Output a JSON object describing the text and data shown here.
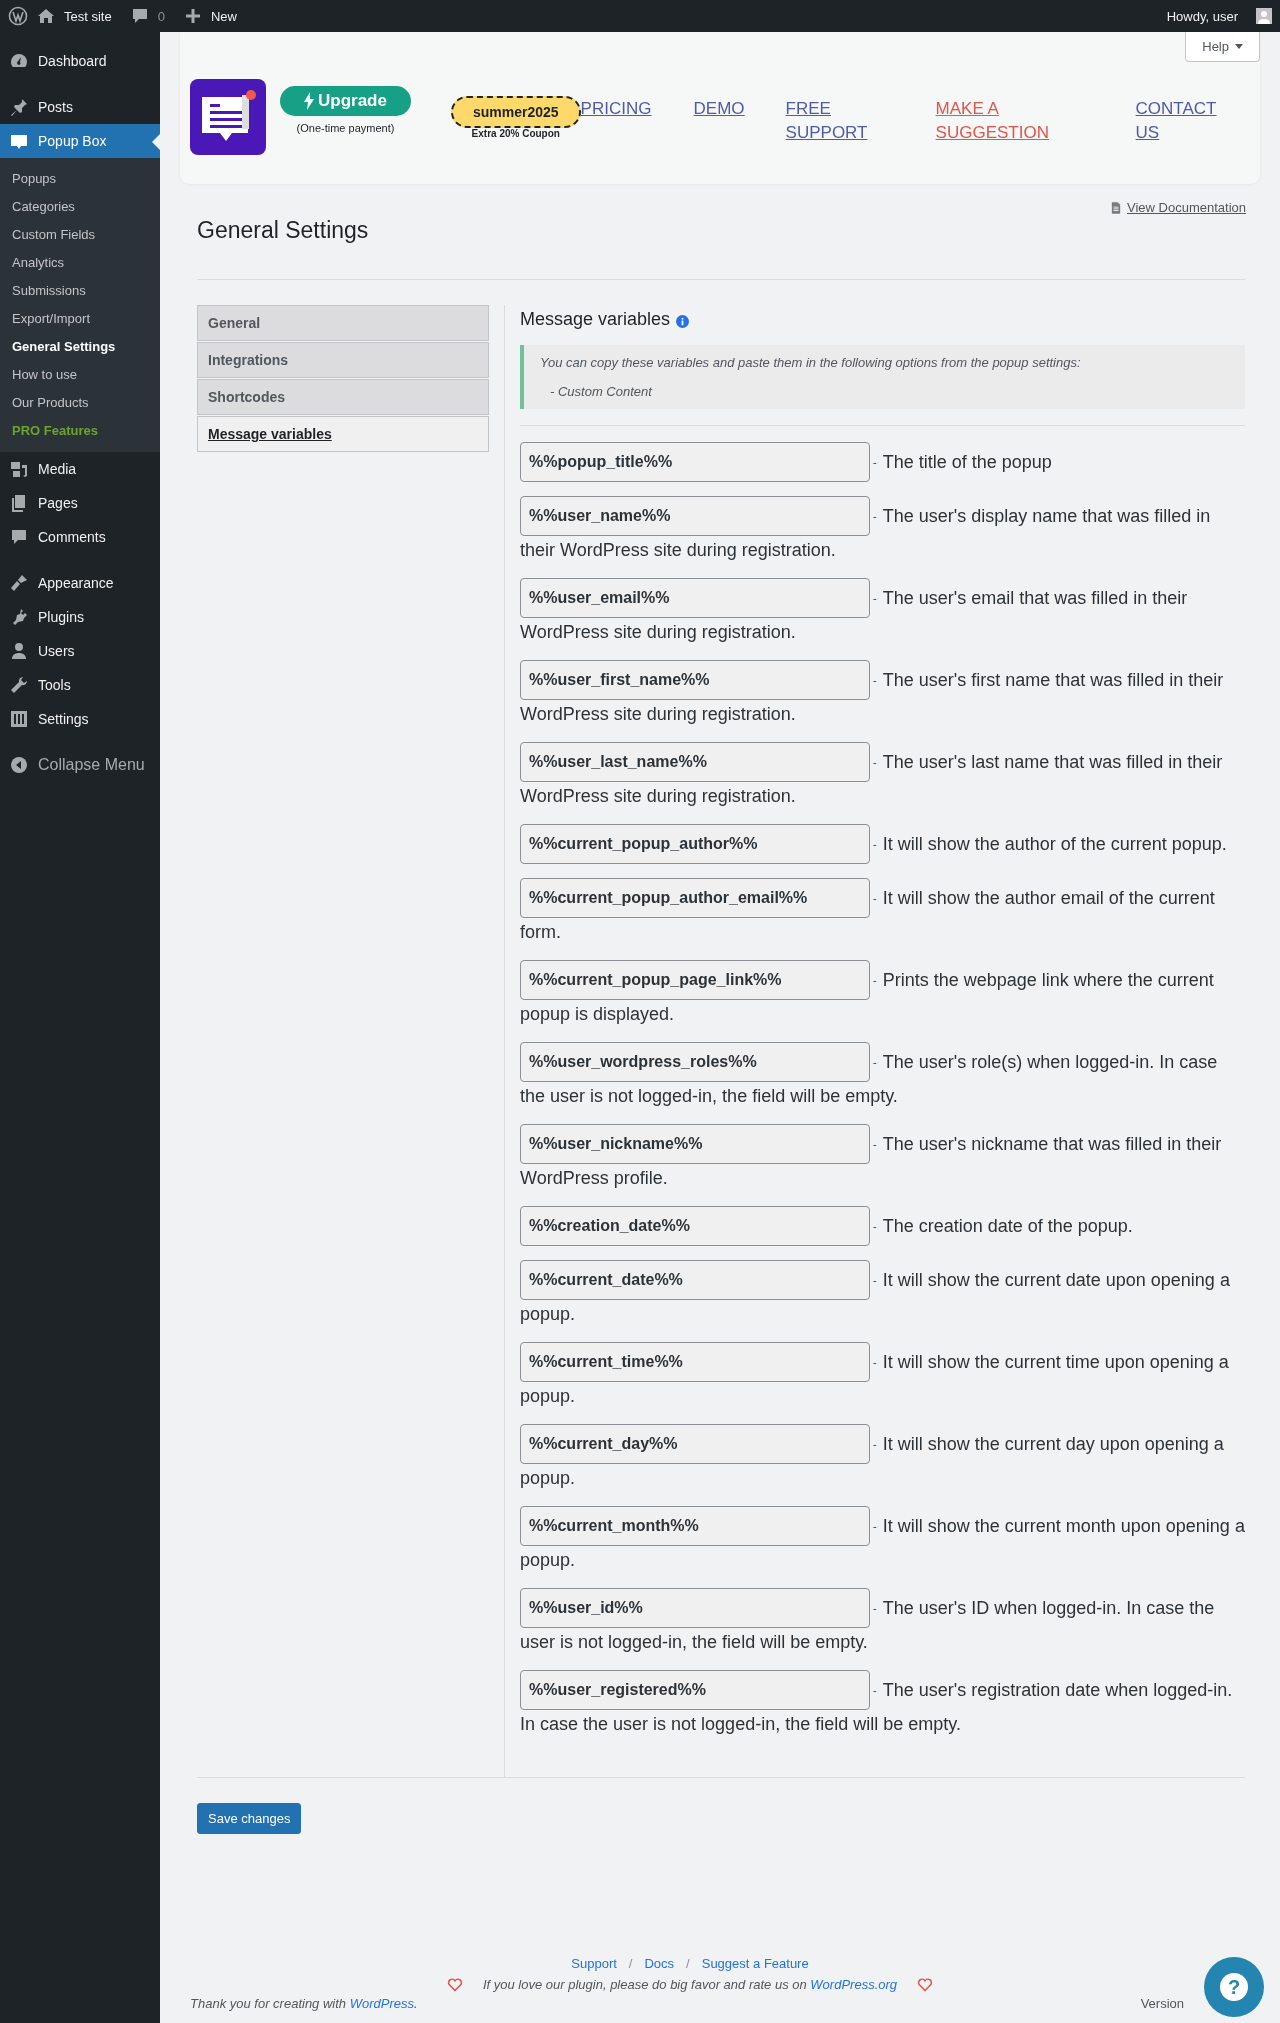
{
  "admin_bar": {
    "site": "Test site",
    "comments": "0",
    "new": "New",
    "greeting": "Howdy, user"
  },
  "sidebar": {
    "groups": [
      [
        {
          "label": "Dashboard",
          "selected": false
        }
      ],
      [
        {
          "label": "Posts",
          "selected": false
        },
        {
          "label": "Popup Box",
          "selected": true,
          "children": [
            {
              "label": "Popups",
              "selected": false,
              "kind": "link"
            },
            {
              "label": "Categories",
              "selected": false,
              "kind": "link"
            },
            {
              "label": "Custom Fields",
              "selected": false,
              "kind": "link"
            },
            {
              "label": "Analytics",
              "selected": false,
              "kind": "link"
            },
            {
              "label": "Submissions",
              "selected": false,
              "kind": "link"
            },
            {
              "label": "Export/Import",
              "selected": false,
              "kind": "link"
            },
            {
              "label": "General Settings",
              "selected": true,
              "kind": "link"
            },
            {
              "label": "How to use",
              "selected": false,
              "kind": "link"
            },
            {
              "label": "Our Products",
              "selected": false,
              "kind": "link"
            },
            {
              "label": "PRO Features",
              "selected": false,
              "kind": "pro"
            }
          ]
        },
        {
          "label": "Media",
          "selected": false
        },
        {
          "label": "Pages",
          "selected": false
        },
        {
          "label": "Comments",
          "selected": false
        }
      ],
      [
        {
          "label": "Appearance",
          "selected": false
        },
        {
          "label": "Plugins",
          "selected": false
        },
        {
          "label": "Users",
          "selected": false
        },
        {
          "label": "Tools",
          "selected": false
        },
        {
          "label": "Settings",
          "selected": false
        }
      ]
    ],
    "collapse": "Collapse Menu"
  },
  "help_button": "Help",
  "header": {
    "upgrade": "Upgrade",
    "upgrade_note": "(One-time payment)",
    "coupon": "summer2025",
    "coupon_note": "Extra 20% Coupon",
    "links": [
      {
        "label": "PRICING",
        "color": "#4f5aa8"
      },
      {
        "label": "DEMO",
        "color": "#4f5aa8"
      },
      {
        "label": "FREE SUPPORT",
        "color": "#4f5aa8"
      },
      {
        "label": "MAKE A SUGGESTION",
        "color": "#e5534b"
      },
      {
        "label": "CONTACT US",
        "color": "#4f5aa8"
      }
    ]
  },
  "view_documentation": "View Documentation",
  "title": "General Settings",
  "tabs": [
    {
      "label": "General",
      "selected": false
    },
    {
      "label": "Integrations",
      "selected": false
    },
    {
      "label": "Shortcodes",
      "selected": false
    },
    {
      "label": "Message variables",
      "selected": true
    }
  ],
  "section_title": "Message variables",
  "note": {
    "text": "You can copy these variables and paste them in the following options from the popup settings:",
    "item": "- Custom Content"
  },
  "variables": [
    {
      "value": "%%popup_title%%",
      "description": [
        "The title of the popup"
      ]
    },
    {
      "value": "%%user_name%%",
      "description": [
        "The user's display name that was filled in",
        "their WordPress site during registration."
      ]
    },
    {
      "value": "%%user_email%%",
      "description": [
        "The user's email that was filled in their",
        "WordPress site during registration."
      ]
    },
    {
      "value": "%%user_first_name%%",
      "description": [
        "The user's first name that was filled in their",
        "WordPress site during registration."
      ]
    },
    {
      "value": "%%user_last_name%%",
      "description": [
        "The user's last name that was filled in their",
        "WordPress site during registration."
      ]
    },
    {
      "value": "%%current_popup_author%%",
      "description": [
        "It will show the author of the current popup."
      ]
    },
    {
      "value": "%%current_popup_author_email%%",
      "description": [
        "It will show the author email of the current",
        "form."
      ]
    },
    {
      "value": "%%current_popup_page_link%%",
      "description": [
        "Prints the webpage link where the current",
        "popup is displayed."
      ]
    },
    {
      "value": "%%user_wordpress_roles%%",
      "description": [
        "The user's role(s) when logged-in. In case",
        "the user is not logged-in, the field will be empty."
      ]
    },
    {
      "value": "%%user_nickname%%",
      "description": [
        "The user's nickname that was filled in their",
        "WordPress profile."
      ]
    },
    {
      "value": "%%creation_date%%",
      "description": [
        "The creation date of the popup."
      ]
    },
    {
      "value": "%%current_date%%",
      "description": [
        "It will show the current date upon opening a",
        "popup."
      ]
    },
    {
      "value": "%%current_time%%",
      "description": [
        "It will show the current time upon opening a",
        "popup."
      ]
    },
    {
      "value": "%%current_day%%",
      "description": [
        "It will show the current day upon opening a",
        "popup."
      ]
    },
    {
      "value": "%%current_month%%",
      "description": [
        "It will show the current month upon opening a",
        "popup."
      ]
    },
    {
      "value": "%%user_id%%",
      "description": [
        "The user's ID when logged-in. In case the",
        "user is not logged-in, the field will be empty."
      ]
    },
    {
      "value": "%%user_registered%%",
      "description": [
        "The user's registration date when logged-in.",
        "In case the user is not logged-in, the field will be empty."
      ]
    }
  ],
  "dash": "-",
  "save_button": "Save changes",
  "footer": {
    "links": [
      "Support",
      "Docs",
      "Suggest a Feature"
    ],
    "separator": "/",
    "rate_text": "If you love our plugin, please do big favor and rate us on ",
    "rate_link": "WordPress.org",
    "thanks_text": "Thank you for creating with ",
    "thanks_link": "WordPress",
    "thanks_end": ".",
    "version": "Version",
    "help_bubble": "?"
  }
}
